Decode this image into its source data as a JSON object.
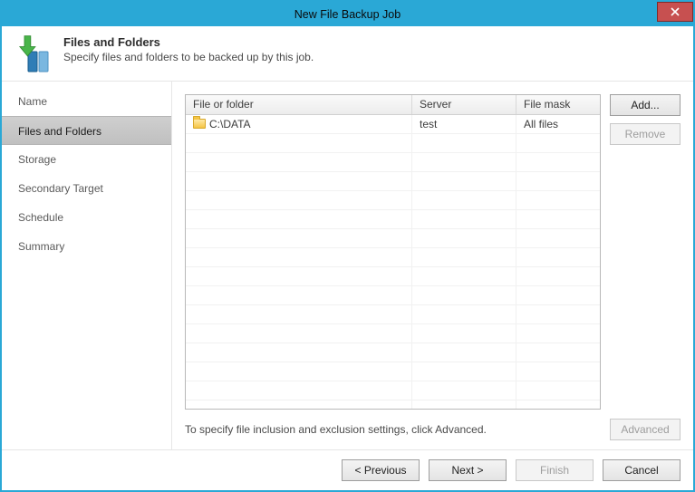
{
  "window": {
    "title": "New File Backup Job"
  },
  "banner": {
    "heading": "Files and Folders",
    "subtitle": "Specify files and folders to be backed up by this job."
  },
  "nav": {
    "items": [
      {
        "label": "Name",
        "active": false
      },
      {
        "label": "Files and Folders",
        "active": true
      },
      {
        "label": "Storage",
        "active": false
      },
      {
        "label": "Secondary Target",
        "active": false
      },
      {
        "label": "Schedule",
        "active": false
      },
      {
        "label": "Summary",
        "active": false
      }
    ]
  },
  "grid": {
    "columns": {
      "file_or_folder": "File or folder",
      "server": "Server",
      "file_mask": "File mask"
    },
    "rows": [
      {
        "file_or_folder": "C:\\DATA",
        "server": "test",
        "file_mask": "All files"
      }
    ]
  },
  "side_buttons": {
    "add": "Add...",
    "remove": "Remove"
  },
  "hint": "To specify file inclusion and exclusion settings, click Advanced.",
  "advanced_label": "Advanced",
  "footer": {
    "previous": "< Previous",
    "next": "Next >",
    "finish": "Finish",
    "cancel": "Cancel"
  }
}
